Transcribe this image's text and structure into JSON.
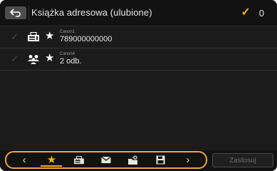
{
  "header": {
    "back_icon": "back-arrow-icon",
    "title": "Książka adresowa (ulubione)",
    "selected_icon": "check-icon",
    "selected_count": "0"
  },
  "entries": [
    {
      "type_icon": "fax-icon",
      "favorite_icon": "star-icon",
      "name": "Canon1",
      "value": "789000000000"
    },
    {
      "type_icon": "group-icon",
      "favorite_icon": "star-icon",
      "name": "Canon4",
      "value": "2 odb."
    }
  ],
  "tabs": [
    {
      "icon": "chevron-left-icon",
      "active": false
    },
    {
      "icon": "star-icon",
      "active": true
    },
    {
      "icon": "fax-icon",
      "active": false
    },
    {
      "icon": "email-icon",
      "active": false
    },
    {
      "icon": "shared-folder-icon",
      "active": false
    },
    {
      "icon": "save-icon",
      "active": false
    },
    {
      "icon": "chevron-right-icon",
      "active": false
    }
  ],
  "apply_label": "Zastosuj",
  "colors": {
    "accent": "#f2b200",
    "highlight_border": "#f2a23c",
    "background": "#1b1b1b"
  }
}
